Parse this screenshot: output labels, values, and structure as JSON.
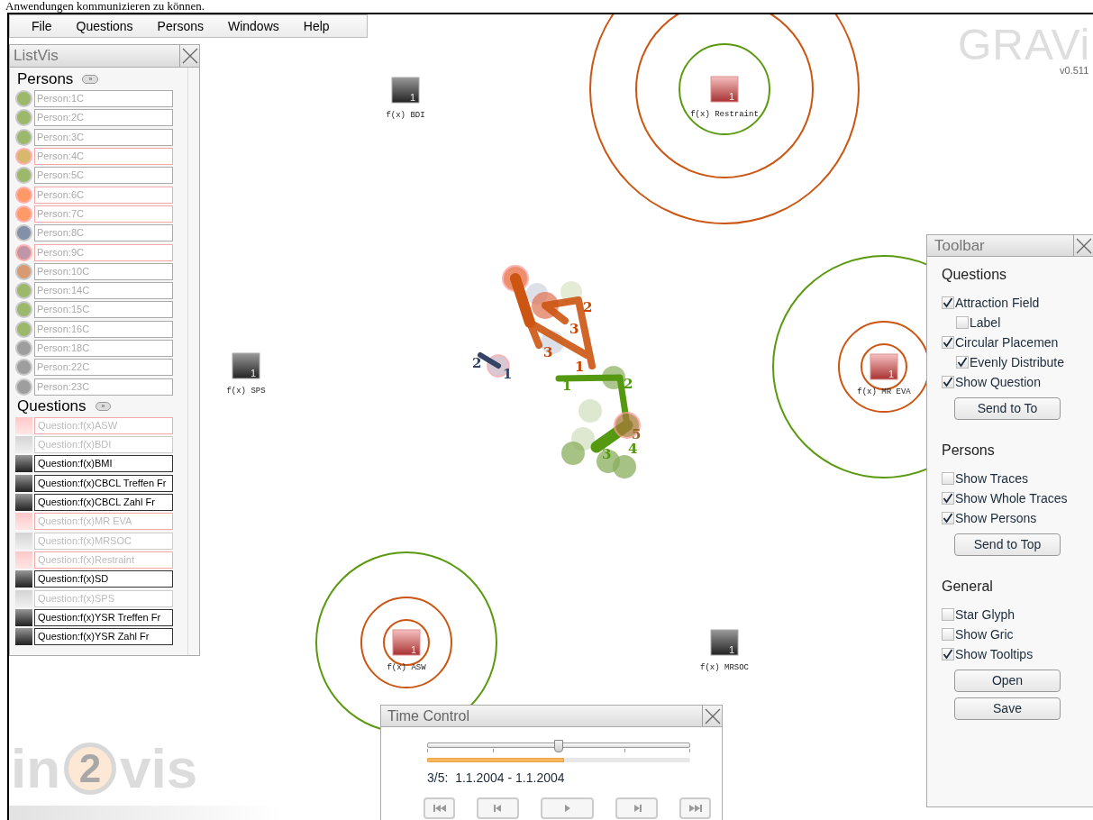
{
  "doc_text": "Anwendungen kommunizieren zu können.",
  "menu": [
    {
      "label": "File"
    },
    {
      "label": "Questions"
    },
    {
      "label": "Persons"
    },
    {
      "label": "Windows"
    },
    {
      "label": "Help"
    }
  ],
  "logo": {
    "text": "GRAVi",
    "version": "v0.511"
  },
  "watermark": {
    "parts": [
      "in",
      "2",
      "vis"
    ]
  },
  "canvas": {
    "nodes": [
      {
        "label": "f(x) BDI",
        "count": "1",
        "highlighted": false
      },
      {
        "label": "f(x) Restraint",
        "count": "1",
        "highlighted": true
      },
      {
        "label": "f(x) SPS",
        "count": "1",
        "highlighted": false
      },
      {
        "label": "f(x) MR EVA",
        "count": "1",
        "highlighted": true
      },
      {
        "label": "f(x) ASW",
        "count": "1",
        "highlighted": true
      },
      {
        "label": "f(x) MRSOC",
        "count": "1",
        "highlighted": false
      }
    ],
    "trace_labels": [
      {
        "text": "1",
        "color": "#334466"
      },
      {
        "text": "2",
        "color": "#334466"
      },
      {
        "text": "2",
        "color": "#cc4400"
      },
      {
        "text": "3",
        "color": "#cc4400"
      },
      {
        "text": "3",
        "color": "#cc4400"
      },
      {
        "text": "1",
        "color": "#cc4400"
      },
      {
        "text": "1",
        "color": "#559911"
      },
      {
        "text": "2",
        "color": "#559911"
      },
      {
        "text": "3",
        "color": "#559911"
      },
      {
        "text": "5",
        "color": "#996622"
      },
      {
        "text": "4",
        "color": "#559911"
      }
    ]
  },
  "listvis": {
    "title": "ListVis",
    "sections": [
      {
        "kind": "persons",
        "title": "Persons",
        "toggle": "»",
        "items": [
          {
            "label": "Person:1C",
            "color": "#9cb86a",
            "highlighted": false
          },
          {
            "label": "Person:2C",
            "color": "#9cb86a",
            "highlighted": false
          },
          {
            "label": "Person:3C",
            "color": "#9cb86a",
            "highlighted": false
          },
          {
            "label": "Person:4C",
            "color": "#d8b86a",
            "highlighted": true
          },
          {
            "label": "Person:5C",
            "color": "#9cb86a",
            "highlighted": false
          },
          {
            "label": "Person:6C",
            "color": "#ff9966",
            "highlighted": true
          },
          {
            "label": "Person:7C",
            "color": "#ff9966",
            "highlighted": true
          },
          {
            "label": "Person:8C",
            "color": "#8290a8",
            "highlighted": false
          },
          {
            "label": "Person:9C",
            "color": "#c096a6",
            "highlighted": true
          },
          {
            "label": "Person:10C",
            "color": "#d89a70",
            "highlighted": false
          },
          {
            "label": "Person:14C",
            "color": "#9cb86a",
            "highlighted": false
          },
          {
            "label": "Person:15C",
            "color": "#9cb86a",
            "highlighted": false
          },
          {
            "label": "Person:16C",
            "color": "#9cb86a",
            "highlighted": false
          },
          {
            "label": "Person:18C",
            "color": "#9e9e9e",
            "highlighted": false
          },
          {
            "label": "Person:22C",
            "color": "#9e9e9e",
            "highlighted": false
          },
          {
            "label": "Person:23C",
            "color": "#9e9e9e",
            "highlighted": false
          }
        ]
      },
      {
        "kind": "questions",
        "title": "Questions",
        "toggle": "»",
        "items": [
          {
            "label": "Question:f(x)ASW",
            "kind": "highlighted"
          },
          {
            "label": "Question:f(x)BDI",
            "kind": "hidden"
          },
          {
            "label": "Question:f(x)BMI",
            "kind": "visible"
          },
          {
            "label": "Question:f(x)CBCL Treffen Fr",
            "kind": "visible"
          },
          {
            "label": "Question:f(x)CBCL Zahl Fr",
            "kind": "visible"
          },
          {
            "label": "Question:f(x)MR EVA",
            "kind": "highlighted"
          },
          {
            "label": "Question:f(x)MRSOC",
            "kind": "hidden"
          },
          {
            "label": "Question:f(x)Restraint",
            "kind": "highlighted"
          },
          {
            "label": "Question:f(x)SD",
            "kind": "visible"
          },
          {
            "label": "Question:f(x)SPS",
            "kind": "hidden"
          },
          {
            "label": "Question:f(x)YSR Treffen Fr",
            "kind": "visible"
          },
          {
            "label": "Question:f(x)YSR Zahl Fr",
            "kind": "visible"
          }
        ]
      }
    ]
  },
  "toolbar": {
    "title": "Toolbar",
    "sections": [
      {
        "title": "Questions",
        "items": [
          {
            "kind": "checkbox",
            "label": "Attraction Field",
            "checked": true
          },
          {
            "kind": "subcheckbox",
            "label": "Label",
            "checked": false
          },
          {
            "kind": "checkbox",
            "label": "Circular Placemen",
            "checked": true
          },
          {
            "kind": "subcheckbox",
            "label": "Evenly Distribute",
            "checked": true
          },
          {
            "kind": "checkbox",
            "label": "Show Question",
            "checked": true
          },
          {
            "kind": "button",
            "label": "Send to To"
          }
        ]
      },
      {
        "title": "Persons",
        "items": [
          {
            "kind": "checkbox",
            "label": "Show Traces",
            "checked": false
          },
          {
            "kind": "checkbox",
            "label": "Show Whole Traces",
            "checked": true
          },
          {
            "kind": "checkbox",
            "label": "Show Persons",
            "checked": true
          },
          {
            "kind": "button",
            "label": "Send to Top"
          }
        ]
      },
      {
        "title": "General",
        "items": [
          {
            "kind": "checkbox",
            "label": "Star Glyph",
            "checked": false
          },
          {
            "kind": "checkbox",
            "label": "Show Gric",
            "checked": false
          },
          {
            "kind": "checkbox",
            "label": "Show Tooltips",
            "checked": true
          },
          {
            "kind": "button",
            "label": "Open"
          },
          {
            "kind": "button",
            "label": "Save"
          }
        ]
      }
    ]
  },
  "time_control": {
    "title": "Time Control",
    "slider": {
      "level": 0.5
    },
    "progress": {
      "level": 0.52
    },
    "reading": "3/5:  1.1.2004 - 1.1.2004",
    "buttons": [
      {
        "kind": "first"
      },
      {
        "kind": "previous"
      },
      {
        "kind": "play"
      },
      {
        "kind": "next"
      },
      {
        "kind": "last"
      }
    ]
  }
}
